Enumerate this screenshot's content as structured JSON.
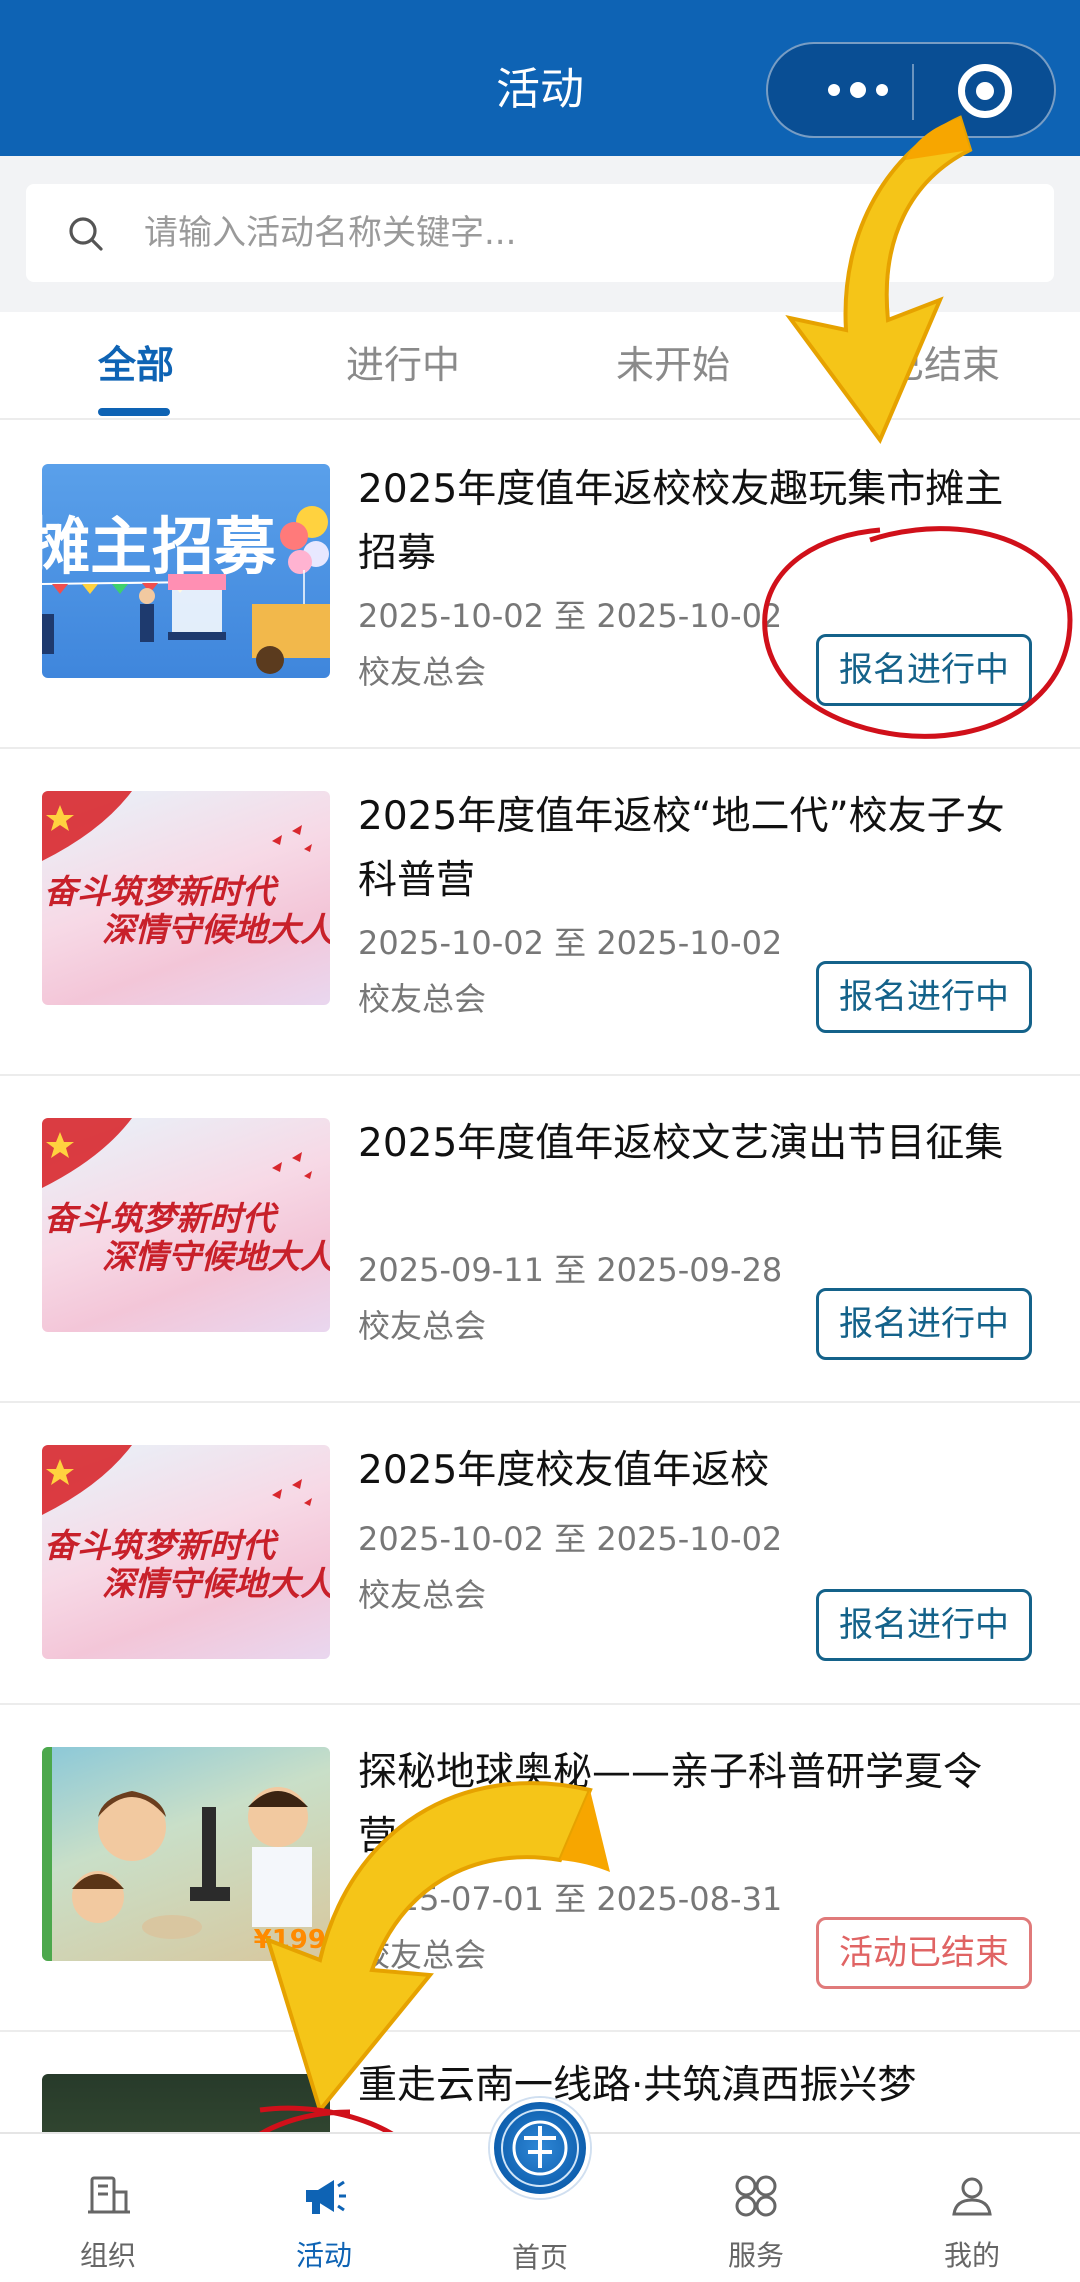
{
  "header": {
    "title": "活动"
  },
  "search": {
    "placeholder": "请输入活动名称关键字..."
  },
  "tabs": [
    {
      "label": "全部",
      "active": true
    },
    {
      "label": "进行中",
      "active": false
    },
    {
      "label": "未开始",
      "active": false
    },
    {
      "label": "已结束",
      "active": false
    }
  ],
  "activities": [
    {
      "title": "2025年度值年返校校友趣玩集市摊主招募",
      "date_range": "2025-10-02 至 2025-10-02",
      "organizer": "校友总会",
      "status": "报名进行中",
      "thumb_text": "摊主招募"
    },
    {
      "title": "2025年度值年返校“地二代”校友子女科普营",
      "date_range": "2025-10-02 至 2025-10-02",
      "organizer": "校友总会",
      "status": "报名进行中",
      "thumb_text_1": "奋斗筑梦新时代",
      "thumb_text_2": "深情守候地大人"
    },
    {
      "title": "2025年度值年返校文艺演出节目征集",
      "date_range": "2025-09-11 至 2025-09-28",
      "organizer": "校友总会",
      "status": "报名进行中",
      "thumb_text_1": "奋斗筑梦新时代",
      "thumb_text_2": "深情守候地大人"
    },
    {
      "title": "2025年度校友值年返校",
      "date_range": "2025-10-02 至 2025-10-02",
      "organizer": "校友总会",
      "status": "报名进行中",
      "thumb_text_1": "奋斗筑梦新时代",
      "thumb_text_2": "深情守候地大人"
    },
    {
      "title": "探秘地球奥秘——亲子科普研学夏令营",
      "date_range": "2025-07-01 至 2025-08-31",
      "organizer": "校友总会",
      "status": "活动已结束",
      "thumb_badge": "¥199"
    },
    {
      "title": "重走云南一线路·共筑滇西振兴梦"
    }
  ],
  "bottom_nav": [
    {
      "label": "组织",
      "icon": "org-icon",
      "active": false
    },
    {
      "label": "活动",
      "icon": "megaphone-icon",
      "active": true
    },
    {
      "label": "首页",
      "icon": "home-emblem-icon",
      "active": false
    },
    {
      "label": "服务",
      "icon": "grid-icon",
      "active": false
    },
    {
      "label": "我的",
      "icon": "user-icon",
      "active": false
    }
  ],
  "colors": {
    "brand": "#0e63b4",
    "status_active": "#14628a",
    "status_ended": "#e06464",
    "arrow": "#f5c518",
    "annotation": "#d0101a"
  }
}
